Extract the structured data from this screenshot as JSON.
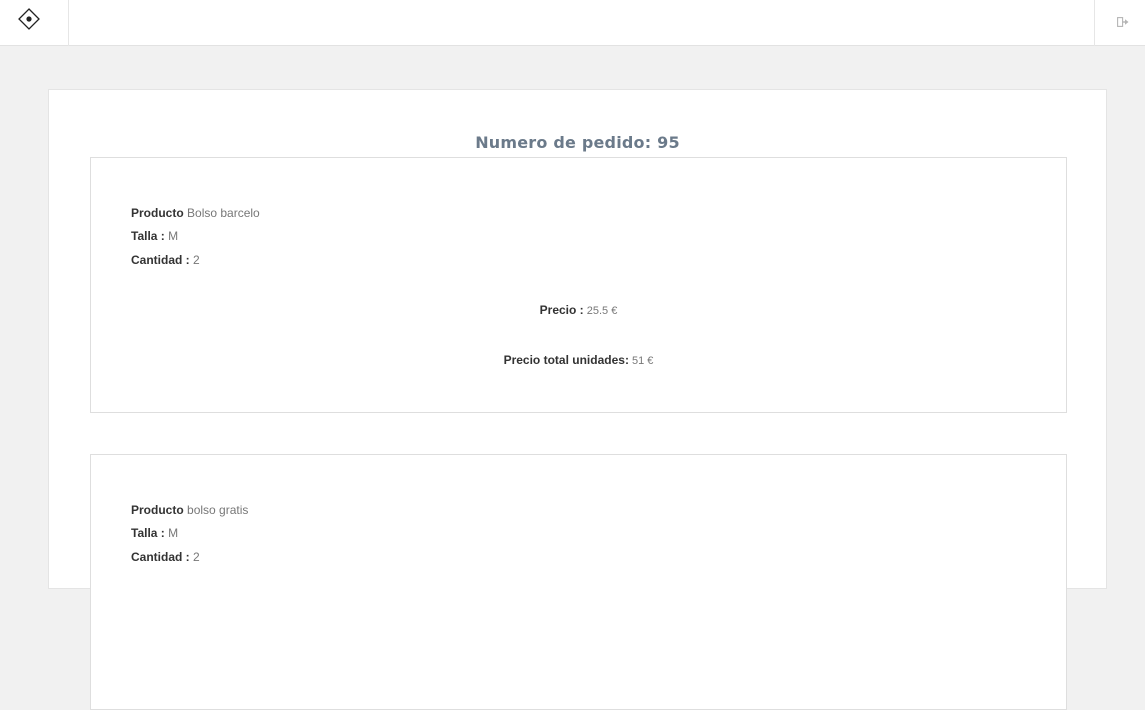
{
  "header": {
    "logo_icon": "diamond-logo-icon",
    "logout_icon": "logout-icon"
  },
  "order": {
    "title_prefix": "Numero de pedido:",
    "number": "95"
  },
  "items": [
    {
      "product_label": "Producto",
      "product_value": "Bolso barcelo",
      "size_label": "Talla :",
      "size_value": "M",
      "quantity_label": "Cantidad :",
      "quantity_value": "2",
      "price_label": "Precio :",
      "price_value": "25.5 €",
      "total_label": "Precio total unidades:",
      "total_value": "51 €"
    },
    {
      "product_label": "Producto",
      "product_value": "bolso gratis",
      "size_label": "Talla :",
      "size_value": "M",
      "quantity_label": "Cantidad :",
      "quantity_value": "2"
    }
  ],
  "colors": {
    "page_background": "#f1f1f1",
    "panel_background": "#ffffff",
    "title_color": "#6b7a8a",
    "label_color": "#333333",
    "value_color": "#777777"
  }
}
